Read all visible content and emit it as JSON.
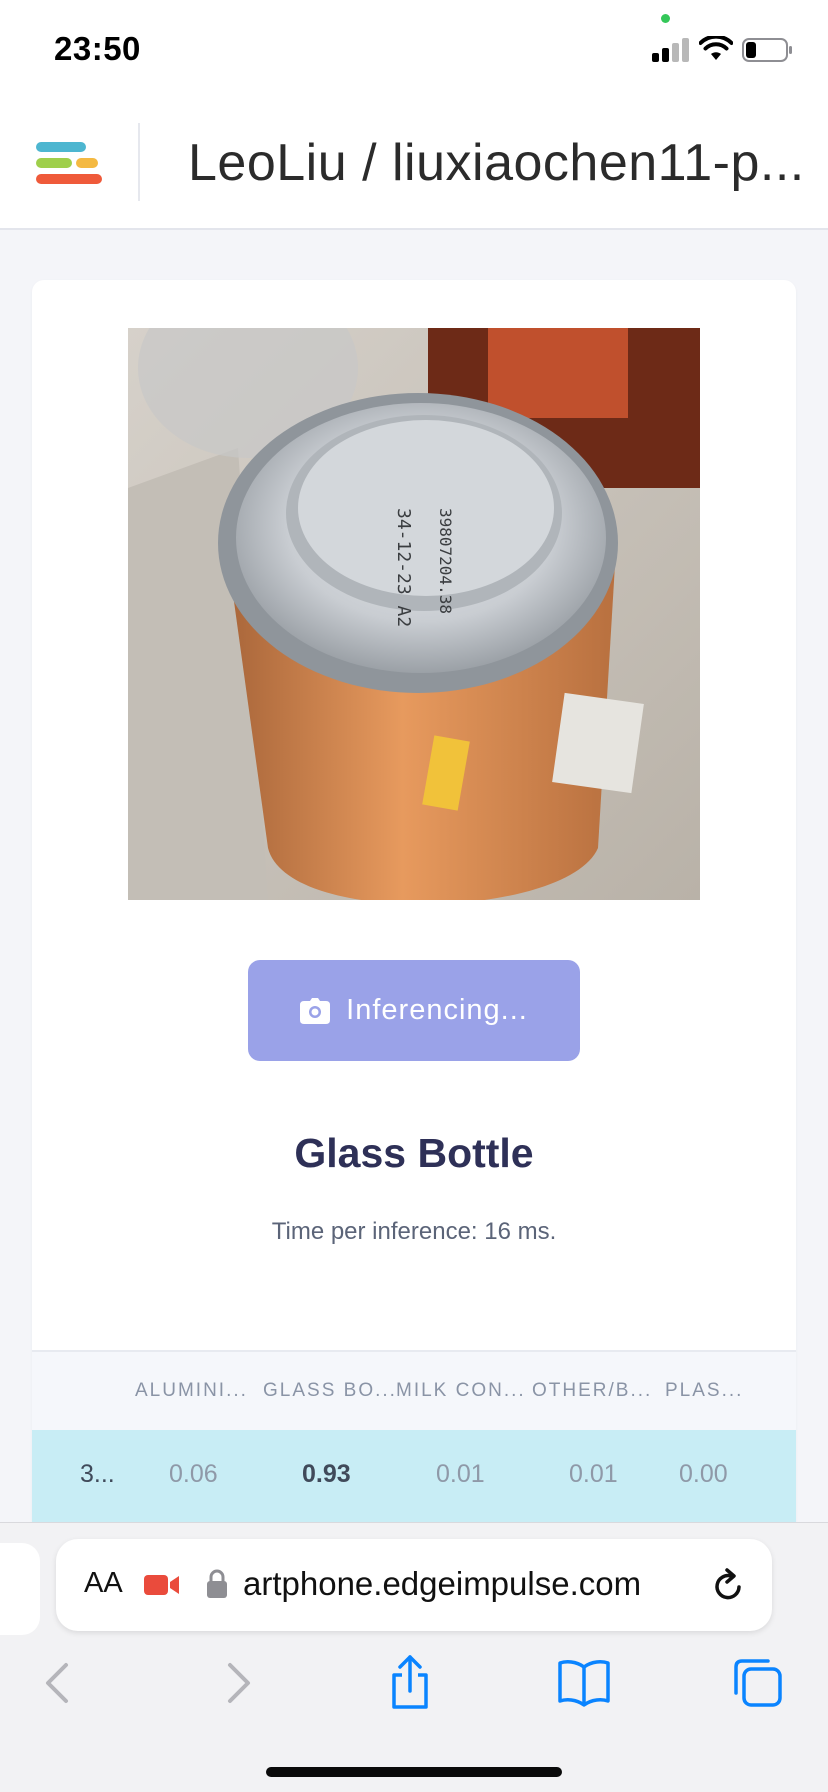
{
  "status_bar": {
    "time": "23:50"
  },
  "header": {
    "project_title": "LeoLiu / liuxiaochen11-p..."
  },
  "main": {
    "inference_button_label": "Inferencing...",
    "result_label": "Glass Bottle",
    "inference_time": "Time per inference: 16 ms."
  },
  "results_table": {
    "headers": [
      "ALUMINI...",
      "GLASS BO...",
      "MILK CON...",
      "OTHER/B...",
      "PLAS..."
    ],
    "row": {
      "first_cell": "3...",
      "values": [
        "0.06",
        "0.93",
        "0.01",
        "0.01",
        "0.00"
      ]
    }
  },
  "browser": {
    "aa_label": "AA",
    "url": "artphone.edgeimpulse.com"
  },
  "colors": {
    "accent_button": "#9aa2e8",
    "highlight_row": "#c8edf5",
    "ios_blue": "#0a84ff",
    "title_color": "#2e3057"
  }
}
